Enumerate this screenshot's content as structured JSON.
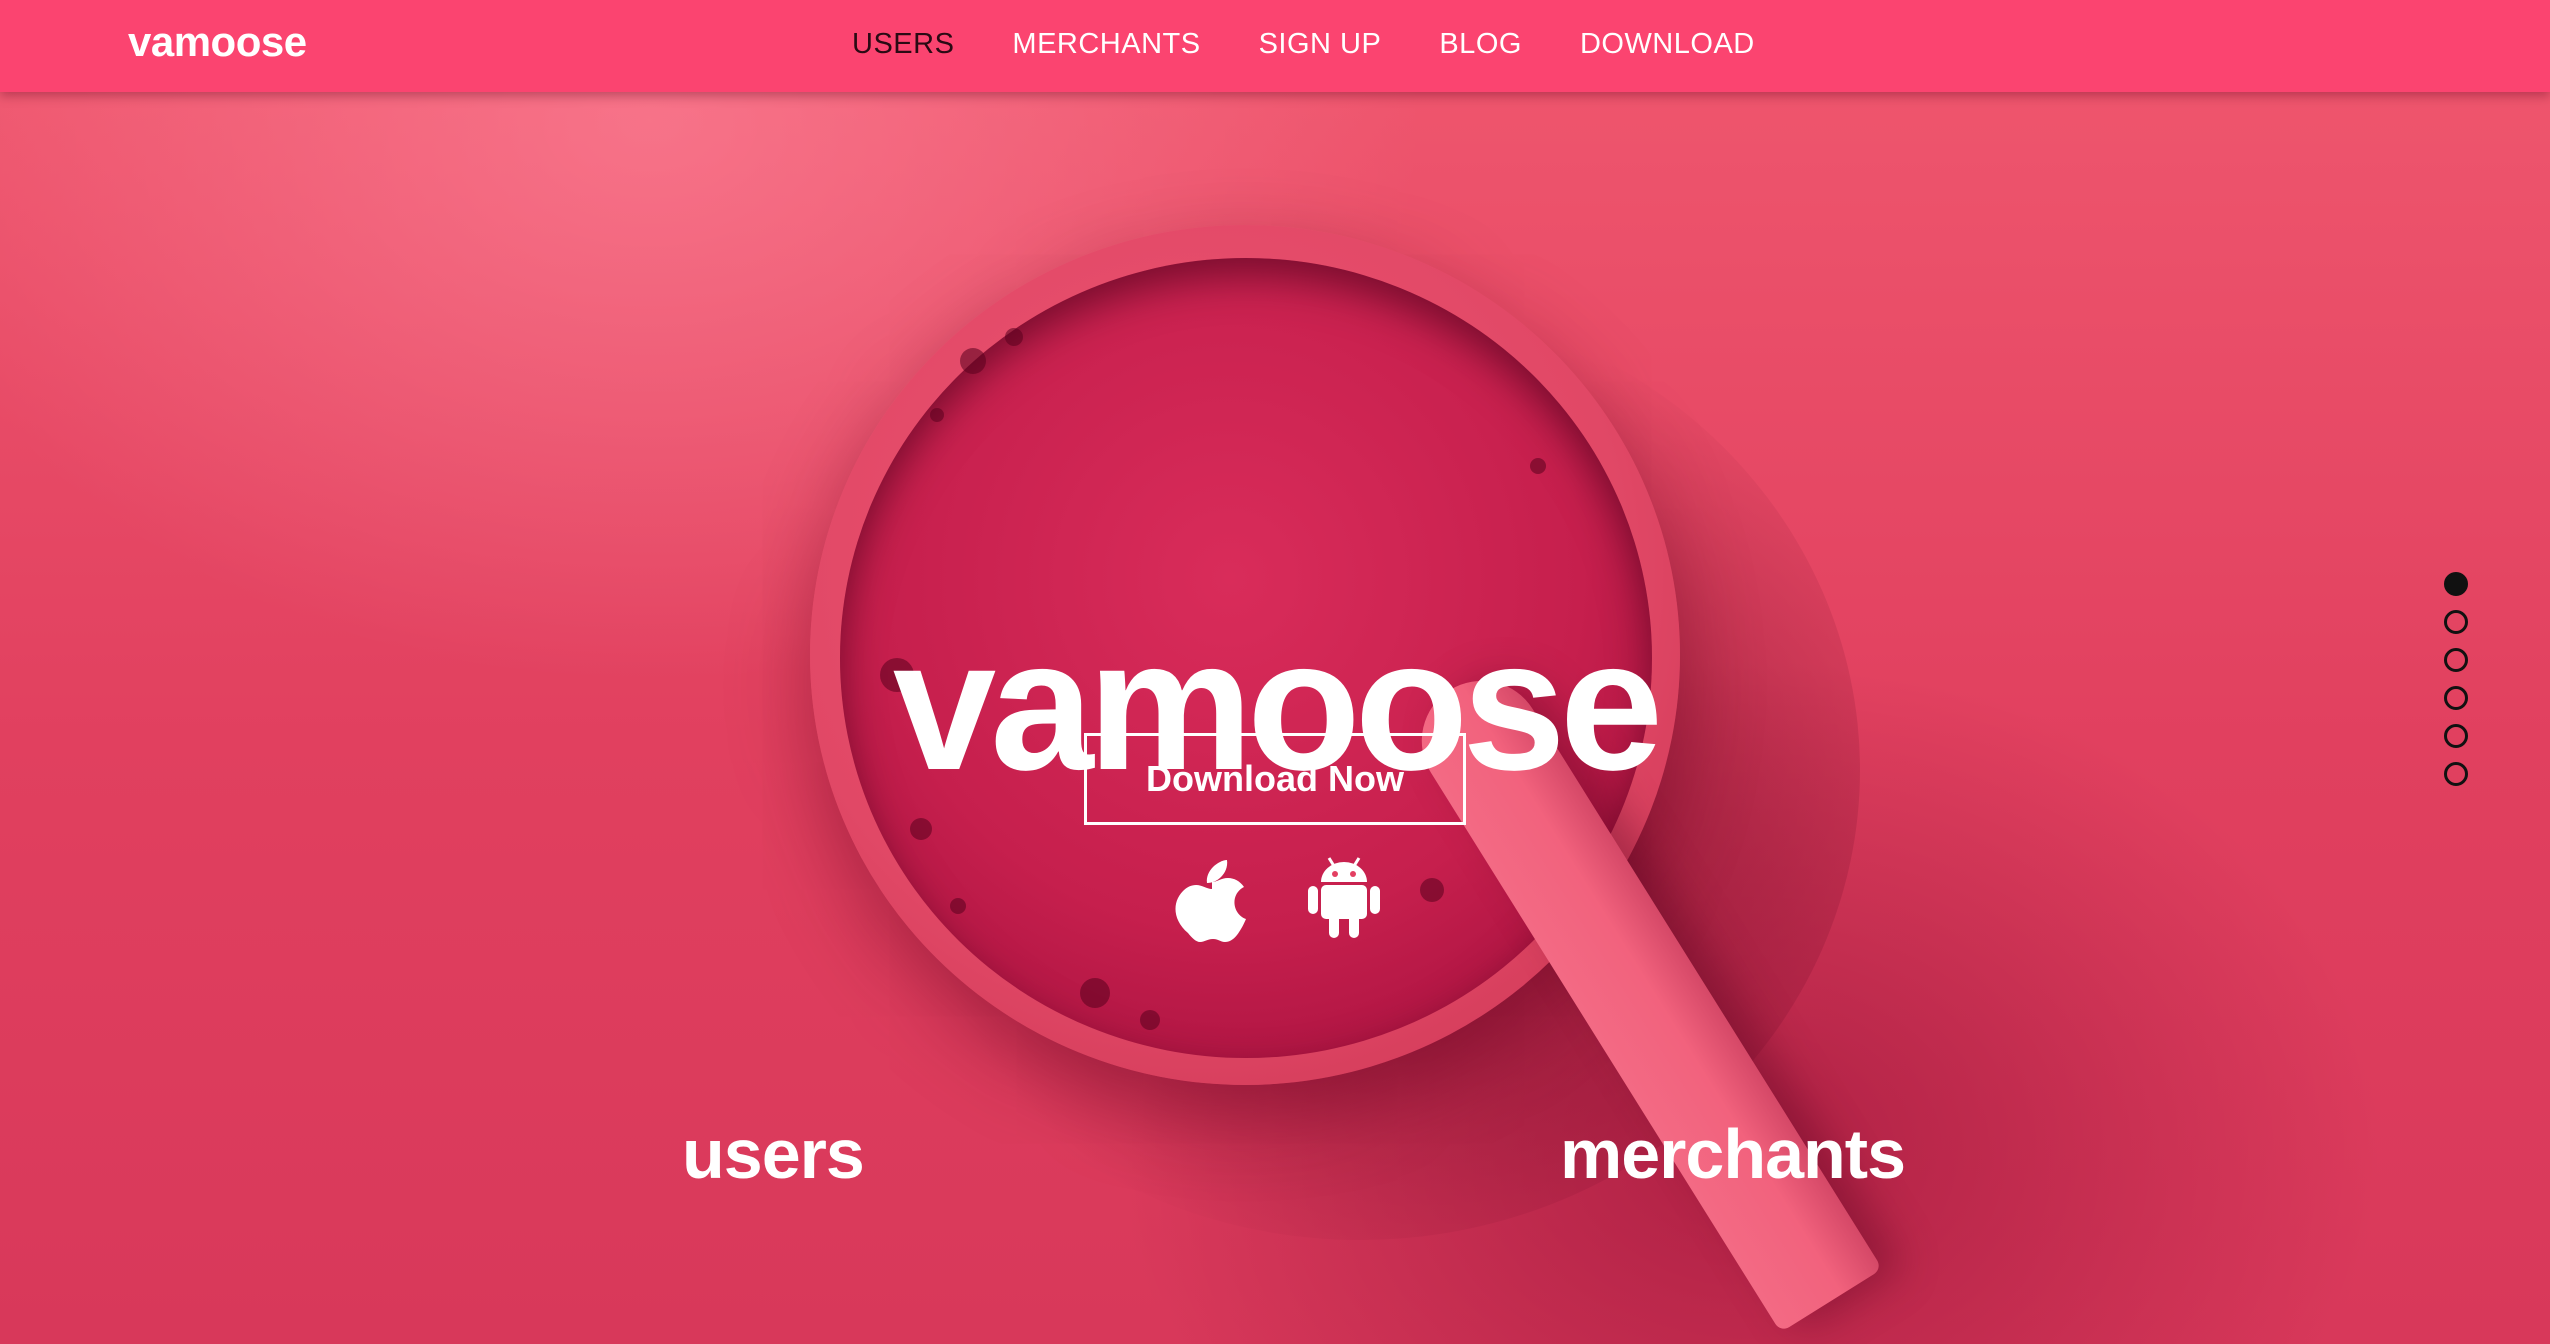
{
  "brand": {
    "name": "vamoose"
  },
  "nav": {
    "items": [
      {
        "label": "USERS",
        "active": true
      },
      {
        "label": "MERCHANTS",
        "active": false
      },
      {
        "label": "SIGN UP",
        "active": false
      },
      {
        "label": "BLOG",
        "active": false
      },
      {
        "label": "DOWNLOAD",
        "active": false
      }
    ]
  },
  "hero": {
    "title": "vamoose",
    "download_button_label": "Download Now",
    "store_icons": [
      "apple-icon",
      "android-icon"
    ]
  },
  "sections": {
    "users_label": "users",
    "merchants_label": "merchants"
  },
  "pagination": {
    "total": 6,
    "active_index": 0
  },
  "colors": {
    "navbar": "#fb4470",
    "accent": "#e33f62",
    "text": "#ffffff",
    "active_nav": "#2a0a14"
  }
}
